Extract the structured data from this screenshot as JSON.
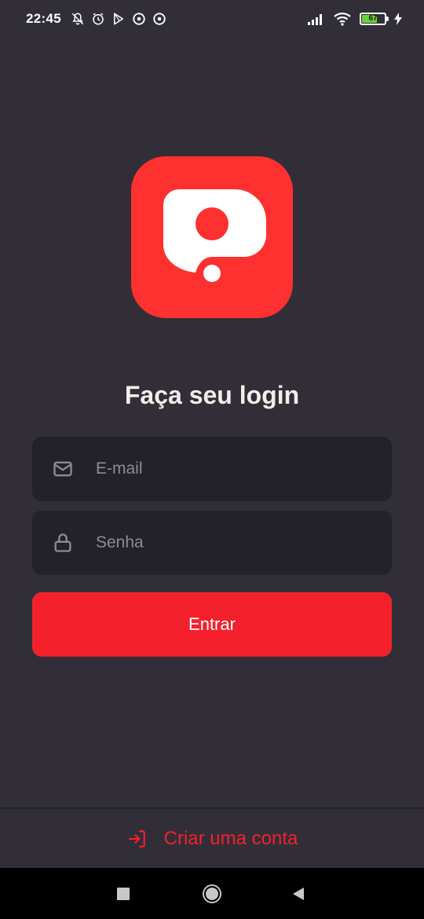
{
  "status_bar": {
    "time": "22:45",
    "battery_level": "67",
    "battery_fraction": 0.67,
    "icons": [
      "notifications-off-icon",
      "alarm-icon",
      "play-store-icon",
      "app-icon",
      "app-icon",
      "signal-icon",
      "wifi-icon",
      "battery-icon",
      "charging-icon"
    ]
  },
  "logo": {
    "icon": "app-logo",
    "color": "#ff3030"
  },
  "login": {
    "title": "Faça seu login",
    "email_placeholder": "E-mail",
    "email_value": "",
    "password_placeholder": "Senha",
    "password_value": "",
    "submit_label": "Entrar"
  },
  "footer": {
    "create_account_label": "Criar uma conta",
    "icon": "log-in-icon"
  },
  "nav_bar": {
    "buttons": [
      "recent-apps-icon",
      "home-icon",
      "back-icon"
    ]
  },
  "colors": {
    "background": "#312e38",
    "input_background": "#232129",
    "accent": "#f4212c",
    "text": "#f4ede8",
    "placeholder": "#8e8b94"
  }
}
